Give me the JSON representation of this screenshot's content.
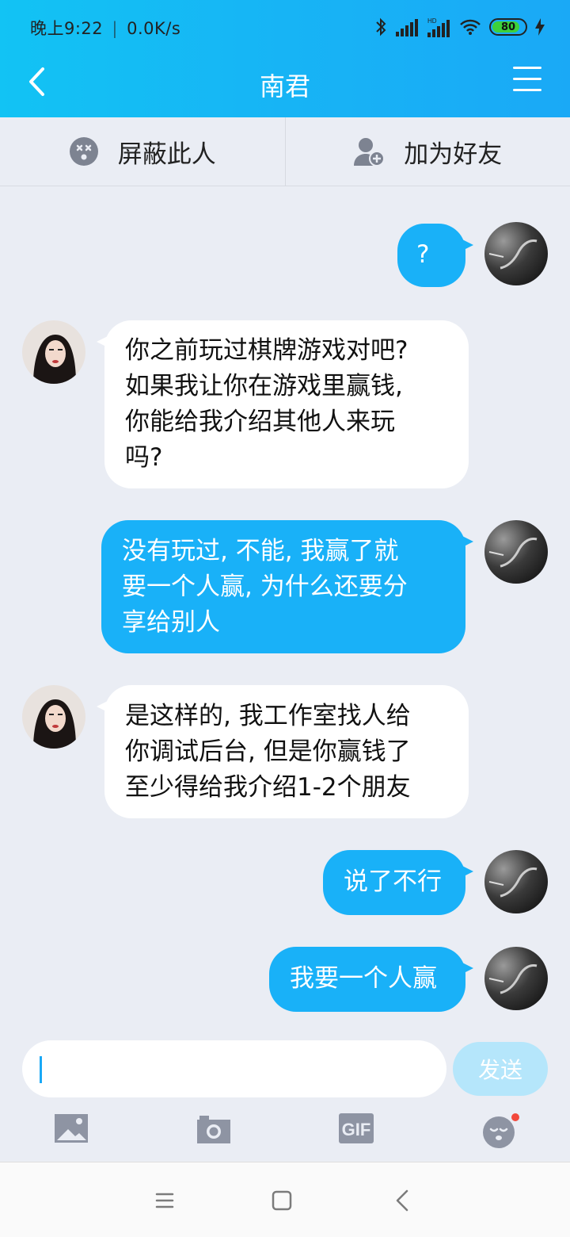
{
  "status": {
    "time": "晚上9:22",
    "network_speed": "0.0K/s",
    "battery": "80"
  },
  "header": {
    "title": "南君"
  },
  "actions": {
    "block_label": "屏蔽此人",
    "add_friend_label": "加为好友"
  },
  "messages": [
    {
      "from": "me",
      "lines": [
        "?"
      ]
    },
    {
      "from": "them",
      "lines": [
        "你之前玩过棋牌游戏对吧?",
        "如果我让你在游戏里赢钱,",
        "你能给我介绍其他人来玩",
        "吗?"
      ]
    },
    {
      "from": "me",
      "lines": [
        "没有玩过, 不能, 我赢了就",
        "要一个人赢, 为什么还要分",
        "享给别人"
      ]
    },
    {
      "from": "them",
      "lines": [
        "是这样的, 我工作室找人给",
        "你调试后台, 但是你赢钱了",
        "至少得给我介绍1-2个朋友"
      ]
    },
    {
      "from": "me",
      "lines": [
        "说了不行"
      ]
    },
    {
      "from": "me",
      "lines": [
        "我要一个人赢"
      ]
    }
  ],
  "composer": {
    "input_value": "",
    "send_label": "发送"
  },
  "colors": {
    "accent": "#19b1f8",
    "background": "#eaedf4",
    "send_disabled": "#b5e6fb"
  },
  "icons": [
    "back-arrow-icon",
    "menu-icon",
    "block-face-icon",
    "add-friend-icon",
    "image-icon",
    "camera-icon",
    "gif-icon",
    "emoji-icon"
  ]
}
